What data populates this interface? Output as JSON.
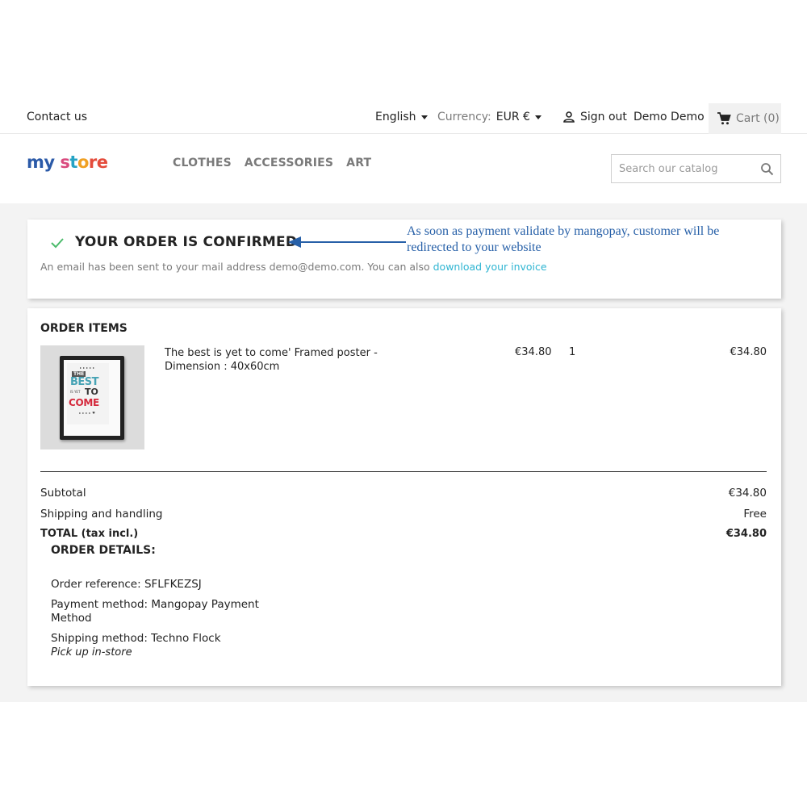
{
  "topbar": {
    "contact_label": "Contact us",
    "language": "English",
    "currency_label": "Currency:",
    "currency_value": "EUR €",
    "signout_label": "Sign out",
    "username": "Demo Demo",
    "cart_label": "Cart (0)"
  },
  "header": {
    "logo": {
      "part1": "my",
      "part2": " s",
      "part3": "t",
      "part4": "o",
      "part5": "re"
    },
    "menu": [
      "CLOTHES",
      "ACCESSORIES",
      "ART"
    ],
    "search_placeholder": "Search our catalog"
  },
  "confirmation": {
    "title": "YOUR ORDER IS CONFIRMED",
    "annotation": "As soon as payment validate by mangopay, customer will be redirected to your website",
    "note_text": "An email has been sent to your mail address demo@demo.com. You can also ",
    "note_link": "download your invoice"
  },
  "order_items": {
    "heading": "ORDER ITEMS",
    "items": [
      {
        "name": "The best is yet to come' Framed poster - Dimension : 40x60cm",
        "unit_price": "€34.80",
        "quantity": "1",
        "total": "€34.80",
        "poster": {
          "the": "THE",
          "best": "BEST",
          "is_yet": "IS YET",
          "to": "TO",
          "come": "COME"
        }
      }
    ],
    "subtotal_label": "Subtotal",
    "subtotal_value": "€34.80",
    "shipping_label": "Shipping and handling",
    "shipping_value": "Free",
    "total_label": "TOTAL (tax incl.)",
    "total_value": "€34.80"
  },
  "order_details": {
    "title": "ORDER DETAILS:",
    "reference": "Order reference: SFLFKEZSJ",
    "payment": "Payment method: Mangopay Payment Method",
    "shipping": "Shipping method: Techno Flock",
    "shipping_note": "Pick up in-store"
  },
  "colors": {
    "accent_link": "#2fb5d2",
    "annotation_blue": "#2760a8",
    "check_green": "#4cbb6c"
  },
  "icons": [
    "check-icon",
    "arrow-left-icon",
    "user-icon",
    "cart-icon",
    "search-icon",
    "caret-down-icon"
  ]
}
